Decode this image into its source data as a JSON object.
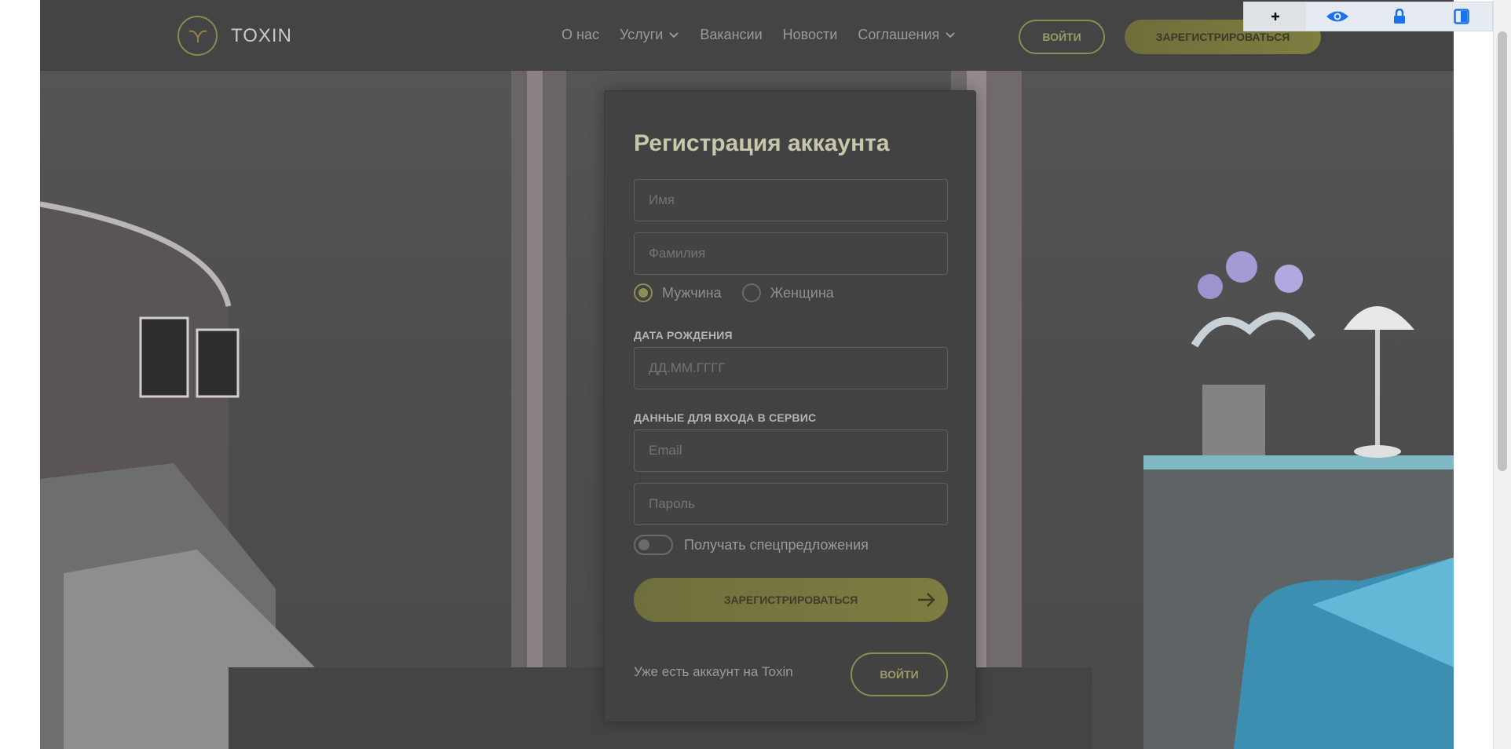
{
  "brand": {
    "name": "TOXIN"
  },
  "nav": {
    "items": [
      {
        "label": "О нас",
        "has_dropdown": false
      },
      {
        "label": "Услуги",
        "has_dropdown": true
      },
      {
        "label": "Вакансии",
        "has_dropdown": false
      },
      {
        "label": "Новости",
        "has_dropdown": false
      },
      {
        "label": "Соглашения",
        "has_dropdown": true
      }
    ],
    "login_label": "ВОЙТИ",
    "register_label": "ЗАРЕГИСТРИРОВАТЬСЯ"
  },
  "toolbar": {
    "icons": [
      "plus-icon",
      "eye-icon",
      "lock-icon",
      "panel-icon"
    ]
  },
  "form": {
    "title": "Регистрация аккаунта",
    "first_name_placeholder": "Имя",
    "last_name_placeholder": "Фамилия",
    "gender": {
      "male_label": "Мужчина",
      "female_label": "Женщина",
      "selected": "male"
    },
    "birth_section_label": "ДАТА РОЖДЕНИЯ",
    "birth_placeholder": "ДД.ММ.ГГГГ",
    "login_section_label": "ДАННЫЕ ДЛЯ ВХОДА В СЕРВИС",
    "email_placeholder": "Email",
    "password_placeholder": "Пароль",
    "offers_toggle_label": "Получать спецпредложения",
    "offers_toggle_on": false,
    "submit_label": "ЗАРЕГИСТРИРОВАТЬСЯ",
    "have_account_text": "Уже есть аккаунт на Toxin",
    "login_label": "ВОЙТИ"
  },
  "colors": {
    "accent": "#8d8d55",
    "header_bg": "#444444",
    "card_bg": "#424242"
  }
}
